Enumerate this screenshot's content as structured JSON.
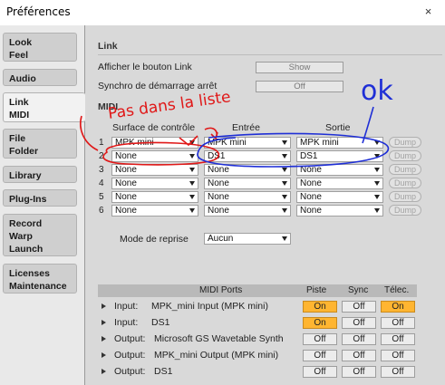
{
  "window": {
    "title": "Préférences",
    "close_glyph": "×"
  },
  "sidebar": {
    "tabs": [
      {
        "lines": [
          "Look",
          "Feel"
        ]
      },
      {
        "lines": [
          "Audio"
        ]
      },
      {
        "lines": [
          "Link",
          "MIDI"
        ]
      },
      {
        "lines": [
          "File",
          "Folder"
        ]
      },
      {
        "lines": [
          "Library"
        ]
      },
      {
        "lines": [
          "Plug-Ins"
        ]
      },
      {
        "lines": [
          "Record",
          "Warp",
          "Launch"
        ]
      },
      {
        "lines": [
          "Licenses",
          "Maintenance"
        ]
      }
    ],
    "active_index": 2
  },
  "link": {
    "section_label": "Link",
    "show_link_label": "Afficher le bouton Link",
    "show_link_value": "Show",
    "start_stop_label": "Synchro de démarrage arrêt",
    "start_stop_value": "Off"
  },
  "midi": {
    "section_label": "MIDI",
    "col_control": "Surface de contrôle",
    "col_input": "Entrée",
    "col_output": "Sortie",
    "dump_label": "Dump",
    "rows": [
      {
        "num": "1",
        "control": "MPK mini",
        "input": "MPK mini",
        "output": "MPK mini"
      },
      {
        "num": "2",
        "control": "None",
        "input": "DS1",
        "output": "DS1"
      },
      {
        "num": "3",
        "control": "None",
        "input": "None",
        "output": "None"
      },
      {
        "num": "4",
        "control": "None",
        "input": "None",
        "output": "None"
      },
      {
        "num": "5",
        "control": "None",
        "input": "None",
        "output": "None"
      },
      {
        "num": "6",
        "control": "None",
        "input": "None",
        "output": "None"
      }
    ],
    "takeover_label": "Mode de reprise",
    "takeover_value": "Aucun"
  },
  "ports": {
    "header": {
      "ports": "MIDI Ports",
      "track": "Piste",
      "sync": "Sync",
      "remote": "Télec."
    },
    "rows": [
      {
        "type": "Input:",
        "name": "MPK_mini Input (MPK mini)",
        "track": "On",
        "sync": "Off",
        "remote": "On"
      },
      {
        "type": "Input:",
        "name": "DS1",
        "track": "On",
        "sync": "Off",
        "remote": "Off"
      },
      {
        "type": "Output:",
        "name": "Microsoft GS Wavetable Synth",
        "track": "Off",
        "sync": "Off",
        "remote": "Off"
      },
      {
        "type": "Output:",
        "name": "MPK_mini Output (MPK mini)",
        "track": "Off",
        "sync": "Off",
        "remote": "Off"
      },
      {
        "type": "Output:",
        "name": "DS1",
        "track": "Off",
        "sync": "Off",
        "remote": "Off"
      }
    ]
  },
  "annotations": {
    "red_text": "Pas dans la liste",
    "blue_text": "ok",
    "red_color": "#e01818",
    "blue_color": "#1f2fd6"
  },
  "colors": {
    "toggle_on": "#ffb531",
    "header_bg": "#b9b9b9",
    "panel_bg": "#d9d9d9"
  }
}
